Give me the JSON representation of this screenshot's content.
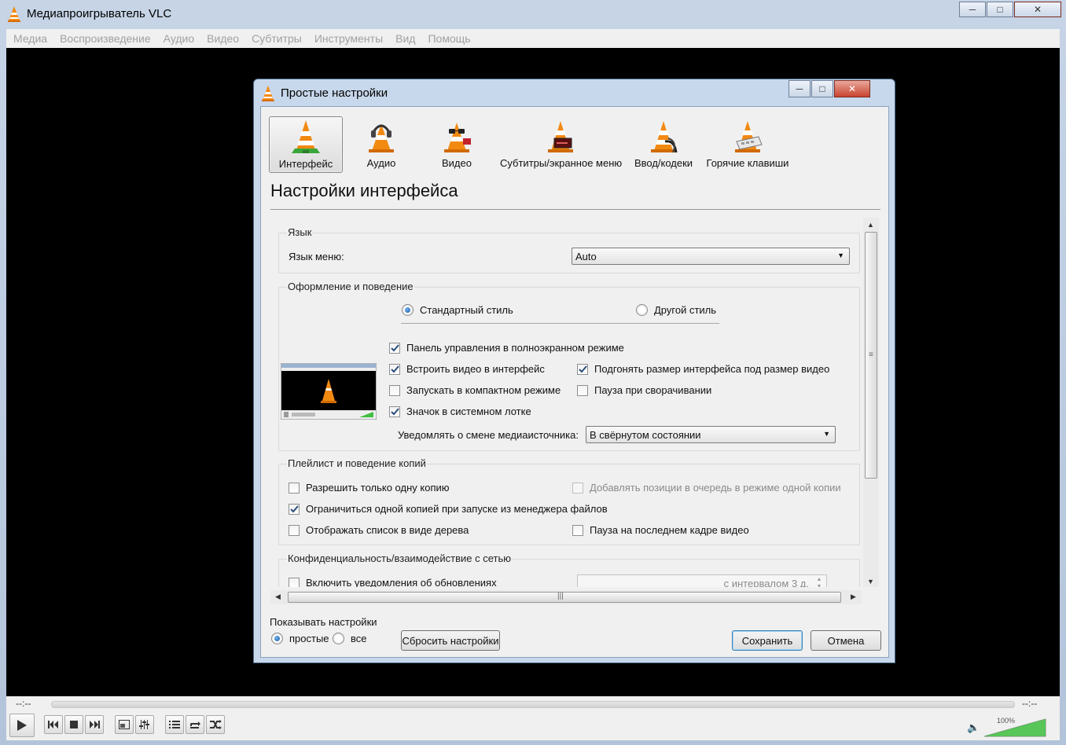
{
  "main_window": {
    "title": "Медиапроигрыватель VLC",
    "menu": [
      "Медиа",
      "Воспроизведение",
      "Аудио",
      "Видео",
      "Субтитры",
      "Инструменты",
      "Вид",
      "Помощь"
    ]
  },
  "player": {
    "elapsed": "--:--",
    "remaining": "--:--",
    "volume_label": "100%",
    "volume_level": 100
  },
  "dialog": {
    "title": "Простые настройки",
    "categories": [
      {
        "label": "Интерфейс",
        "icon": "interface-cone-icon",
        "selected": true
      },
      {
        "label": "Аудио",
        "icon": "audio-headphones-cone-icon",
        "selected": false
      },
      {
        "label": "Видео",
        "icon": "video-glasses-cone-icon",
        "selected": false
      },
      {
        "label": "Субтитры/экранное меню",
        "icon": "subtitles-cone-icon",
        "selected": false
      },
      {
        "label": "Ввод/кодеки",
        "icon": "input-codecs-cone-icon",
        "selected": false
      },
      {
        "label": "Горячие клавиши",
        "icon": "hotkeys-cone-icon",
        "selected": false
      }
    ],
    "section_title": "Настройки интерфейса",
    "language": {
      "group": "Язык",
      "label": "Язык меню:",
      "value": "Auto"
    },
    "look": {
      "group": "Оформление и поведение",
      "native_style": "Стандартный стиль",
      "skin_style": "Другой стиль",
      "fs_controller": "Панель управления в полноэкранном режиме",
      "embed_video": "Встроить видео в интерфейс",
      "resize_to_video": "Подгонять размер интерфейса под размер видео",
      "minimal_start": "Запускать в компактном режиме",
      "pause_minimized": "Пауза при сворачивании",
      "systray": "Значок в системном лотке",
      "notify_label": "Уведомлять о смене медиаисточника:",
      "notify_value": "В свёрнутом состоянии"
    },
    "playlist": {
      "group": "Плейлист и поведение копий",
      "one_instance": "Разрешить только одну копию",
      "enqueue": "Добавлять позиции в очередь в режиме одной копии",
      "one_instance_fm": "Ограничиться одной копией при запуске из менеджера файлов",
      "tree": "Отображать список в виде дерева",
      "pause_last": "Пауза на последнем кадре видео"
    },
    "privacy": {
      "group": "Конфиденциальность/взаимодействие с сетью",
      "updates": "Включить уведомления об обновлениях",
      "interval": "с интервалом 3 д."
    },
    "show_settings": {
      "label": "Показывать настройки",
      "simple": "простые",
      "all": "все"
    },
    "buttons": {
      "reset": "Сбросить настройки",
      "save": "Сохранить",
      "cancel": "Отмена"
    }
  }
}
